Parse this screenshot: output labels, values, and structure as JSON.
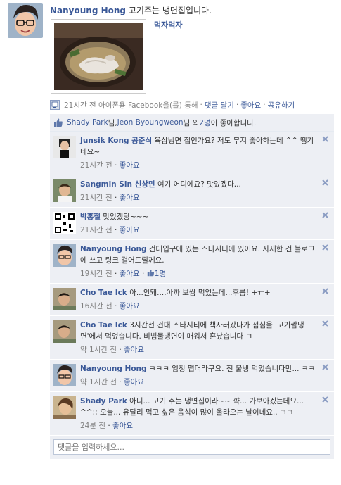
{
  "post": {
    "author": "Nanyoung Hong",
    "text": "고기주는 냉면집입니다.",
    "photo_caption": "먹자먹자",
    "time": "21시간 전",
    "via": "아이폰용 Facebook을(를) 통해",
    "comment_link": "댓글 달기",
    "like_link": "좋아요",
    "share_link": "공유하기"
  },
  "likes": {
    "name1": "Shady Park",
    "sep1": "님, ",
    "name2": "Jeon Byoungweon",
    "sep2": "님 외 ",
    "others": "2명",
    "suffix": "이 좋아합니다."
  },
  "comments": [
    {
      "name": "Junsik Kong 공준식",
      "text": "육삼냉면 집인가요? 저도 무지 좋아하는데 ^^ 땡기네요~",
      "time": "21시간 전",
      "like": "좋아요",
      "count": ""
    },
    {
      "name": "Sangmin Sin 신상민",
      "text": "여기 어디에요? 맛있겠다...",
      "time": "21시간 전",
      "like": "좋아요",
      "count": ""
    },
    {
      "name": "박홍철",
      "text": "맛있겠당~~~",
      "time": "21시간 전",
      "like": "좋아요",
      "count": ""
    },
    {
      "name": "Nanyoung Hong",
      "text": "건대입구에 있는 스타시티에 있어요. 자세한 건 블로그에 쓰고 링크 걸어드릴께요.",
      "time": "19시간 전",
      "like": "좋아요",
      "count": "1명"
    },
    {
      "name": "Cho Tae Ick",
      "text": "아...안돼....아까 보쌈 먹었는데...후릅! +ㅠ+",
      "time": "16시간 전",
      "like": "좋아요",
      "count": ""
    },
    {
      "name": "Cho Tae Ick",
      "text": "3시간전 건대 스타시티에 책사러갔다가 점심을 '고기쌈냉면'에서 먹었습니다. 비빔물냉면이 매워서 혼났습니다 ㅋ",
      "time": "약 1시간 전",
      "like": "좋아요",
      "count": ""
    },
    {
      "name": "Nanyoung Hong",
      "text": "ㅋㅋㅋ 엄청 맵더라구요. 전 물냉 먹었습니다만... ㅋㅋ",
      "time": "약 1시간 전",
      "like": "좋아요",
      "count": ""
    },
    {
      "name": "Shady Park",
      "text": "아니... 고기 주는 냉면집이라~~ 꺅... 가보아겠는데요... ^^;; 오늘... 유달리 먹고 싶은 음식이 많이 올라오는 날이네요.. ㅋㅋ",
      "time": "24분 전",
      "like": "좋아요",
      "count": ""
    }
  ],
  "comment_input": {
    "placeholder": "댓글을 입력하세요..."
  }
}
